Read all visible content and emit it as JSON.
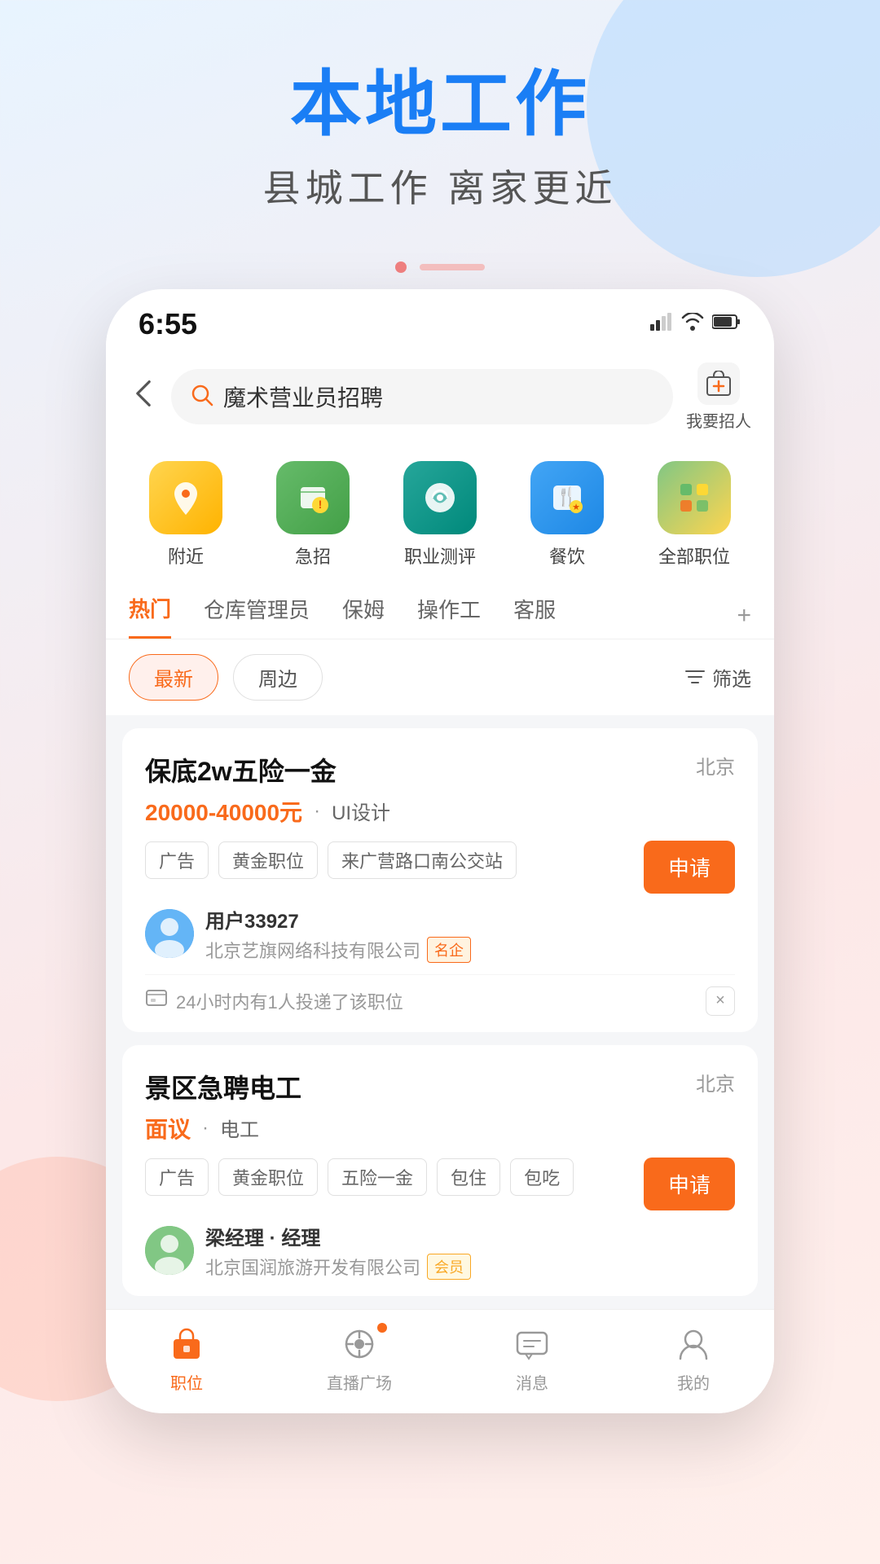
{
  "page": {
    "background_gradient": "linear-gradient(160deg, #e8f4ff 0%, #fce8e8 60%, #fff0ec 100%)"
  },
  "header": {
    "main_title": "本地工作",
    "sub_title": "县城工作  离家更近"
  },
  "phone": {
    "status_bar": {
      "time": "6:55",
      "signal": "📶",
      "wifi": "📡",
      "battery": "🔋"
    },
    "search": {
      "placeholder": "魔术营业员招聘",
      "back_label": "‹",
      "recruit_label": "我要招人"
    },
    "categories": [
      {
        "id": "nearby",
        "icon": "📍",
        "label": "附近",
        "color_class": "cat-nearby"
      },
      {
        "id": "urgent",
        "icon": "💼",
        "label": "急招",
        "color_class": "cat-urgent"
      },
      {
        "id": "career",
        "icon": "📊",
        "label": "职业测评",
        "color_class": "cat-career"
      },
      {
        "id": "food",
        "icon": "🍴",
        "label": "餐饮",
        "color_class": "cat-food"
      },
      {
        "id": "all",
        "icon": "⊞",
        "label": "全部职位",
        "color_class": "cat-all"
      }
    ],
    "tabs": [
      {
        "id": "hot",
        "label": "热门",
        "active": true
      },
      {
        "id": "warehouse",
        "label": "仓库管理员",
        "active": false
      },
      {
        "id": "nanny",
        "label": "保姆",
        "active": false
      },
      {
        "id": "operator",
        "label": "操作工",
        "active": false
      },
      {
        "id": "service",
        "label": "客服",
        "active": false
      }
    ],
    "filters": [
      {
        "id": "latest",
        "label": "最新",
        "active": true
      },
      {
        "id": "nearby_filter",
        "label": "周边",
        "active": false
      }
    ],
    "filter_label": "筛选",
    "jobs": [
      {
        "id": "job1",
        "title": "保底2w五险一金",
        "location": "北京",
        "salary": "20000-40000元",
        "salary_type": "range",
        "job_type": "UI设计",
        "tags": [
          "广告",
          "黄金职位",
          "来广营路口南公交站"
        ],
        "apply_label": "申请",
        "recruiter_name": "用户33927",
        "recruiter_company": "北京艺旗网络科技有限公司",
        "recruiter_badge": "名企",
        "recruiter_badge_type": "named",
        "notice_text": "24小时内有1人投递了该职位",
        "avatar_class": "avatar1"
      },
      {
        "id": "job2",
        "title": "景区急聘电工",
        "location": "北京",
        "salary": "面议",
        "salary_type": "negotiable",
        "job_type": "电工",
        "tags": [
          "广告",
          "黄金职位",
          "五险一金",
          "包住",
          "包吃"
        ],
        "apply_label": "申请",
        "recruiter_name": "梁经理·经理",
        "recruiter_company": "北京国润旅游开发有限公司",
        "recruiter_badge": "会员",
        "recruiter_badge_type": "vip",
        "avatar_class": "avatar2"
      }
    ],
    "bottom_nav": [
      {
        "id": "jobs",
        "label": "职位",
        "active": true,
        "icon": "home"
      },
      {
        "id": "live",
        "label": "直播广场",
        "active": false,
        "icon": "live",
        "has_dot": true
      },
      {
        "id": "message",
        "label": "消息",
        "active": false,
        "icon": "msg"
      },
      {
        "id": "mine",
        "label": "我的",
        "active": false,
        "icon": "user"
      }
    ]
  }
}
